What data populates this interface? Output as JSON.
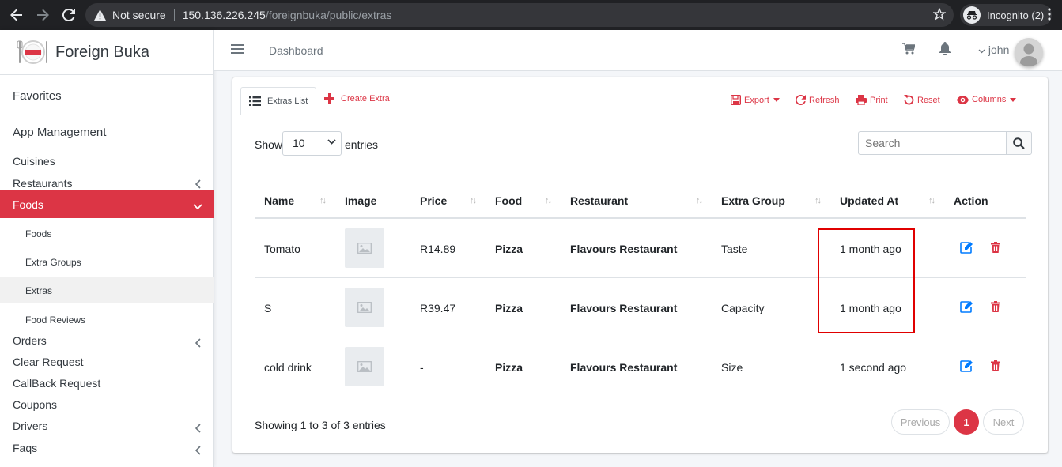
{
  "browser": {
    "not_secure": "Not secure",
    "url_host": "150.136.226.245",
    "url_path": "/foreignbuka/public/extras",
    "incognito": "Incognito (2)"
  },
  "brand": {
    "name": "Foreign Buka"
  },
  "sidebar": {
    "favorites": "Favorites",
    "app_management": "App Management",
    "cuisines": "Cuisines",
    "restaurants": "Restaurants",
    "foods": "Foods",
    "sub": [
      "Foods",
      "Extra Groups",
      "Extras",
      "Food Reviews"
    ],
    "orders": "Orders",
    "clear_request": "Clear Request",
    "callback_request": "CallBack Request",
    "coupons": "Coupons",
    "drivers": "Drivers",
    "faqs": "Faqs"
  },
  "topbar": {
    "breadcrumb": "Dashboard",
    "user": "john"
  },
  "tabs": {
    "list": "Extras List",
    "create": "Create Extra"
  },
  "toolbar": {
    "export": "Export",
    "refresh": "Refresh",
    "print": "Print",
    "reset": "Reset",
    "columns": "Columns"
  },
  "filter": {
    "show": "Show",
    "page_size": "10",
    "entries": "entries",
    "search_placeholder": "Search"
  },
  "table": {
    "headers": [
      "Name",
      "Image",
      "Price",
      "Food",
      "Restaurant",
      "Extra Group",
      "Updated At",
      "Action"
    ],
    "rows": [
      {
        "name": "Tomato",
        "price": "R14.89",
        "food": "Pizza",
        "restaurant": "Flavours Restaurant",
        "extra_group": "Taste",
        "updated": "1 month ago"
      },
      {
        "name": "S",
        "price": "R39.47",
        "food": "Pizza",
        "restaurant": "Flavours Restaurant",
        "extra_group": "Capacity",
        "updated": "1 month ago"
      },
      {
        "name": "cold drink",
        "price": "-",
        "food": "Pizza",
        "restaurant": "Flavours Restaurant",
        "extra_group": "Size",
        "updated": "1 second ago"
      }
    ]
  },
  "footer": {
    "info": "Showing 1 to 3 of 3 entries",
    "previous": "Previous",
    "current_page": "1",
    "next": "Next"
  },
  "colors": {
    "accent": "#dc3545",
    "edit": "#007bff",
    "highlight": "#e00000"
  }
}
